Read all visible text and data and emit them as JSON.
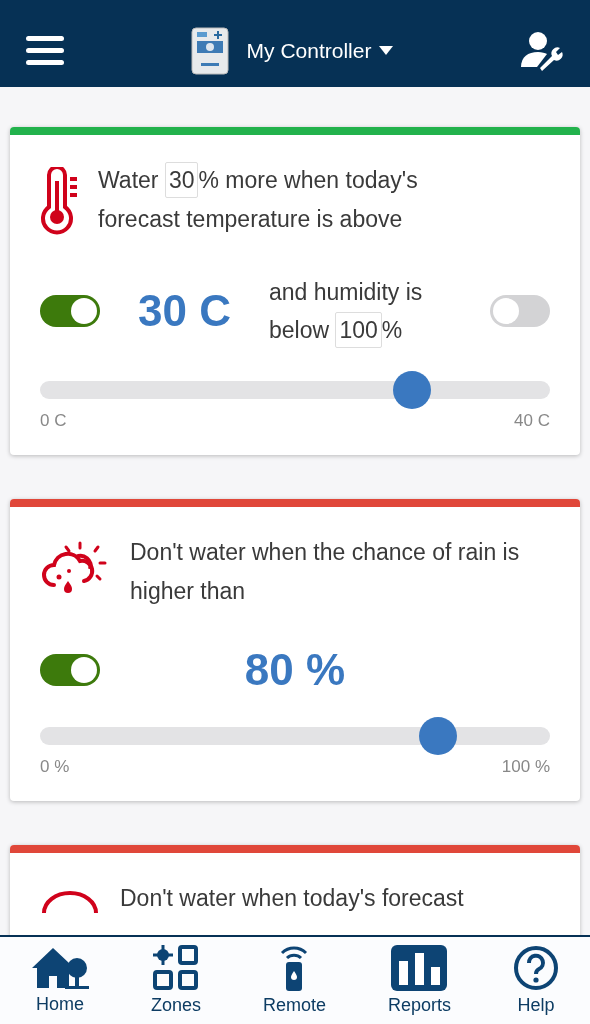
{
  "header": {
    "title": "My Controller"
  },
  "cards": [
    {
      "kind": "temperature",
      "color": "#22b24c",
      "text_before": "Water",
      "amount": "30",
      "text_after": "% more when today's",
      "text_line2": "forecast temperature is above",
      "enabled": true,
      "value": "30 C",
      "humidity": {
        "text_line1": "and humidity is",
        "text_before": "below",
        "amount": "100",
        "text_after": "%",
        "enabled": false
      },
      "slider": {
        "level": 0.73,
        "min_label": "0 C",
        "max_label": "40 C"
      }
    },
    {
      "kind": "rain",
      "color": "#e0473a",
      "text": "Don't water when the chance of rain is higher than",
      "enabled": true,
      "value": "80 %",
      "slider": {
        "level": 0.78,
        "min_label": "0 %",
        "max_label": "100 %"
      }
    },
    {
      "kind": "forecast",
      "color": "#e0473a",
      "text": "Don't water when today's forecast"
    }
  ],
  "nav": [
    {
      "kind": "home",
      "label": "Home"
    },
    {
      "kind": "zones",
      "label": "Zones"
    },
    {
      "kind": "remote",
      "label": "Remote"
    },
    {
      "kind": "reports",
      "label": "Reports"
    },
    {
      "kind": "help",
      "label": "Help"
    }
  ]
}
